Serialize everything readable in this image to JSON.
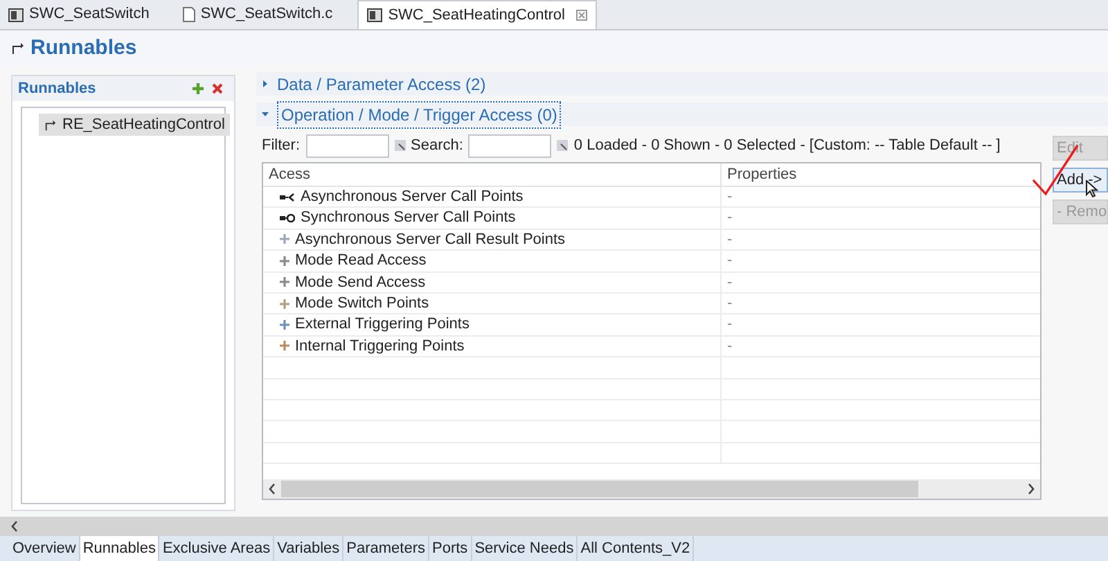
{
  "editor_tabs": [
    {
      "label": "SWC_SeatSwitch",
      "kind": "component",
      "selected": false
    },
    {
      "label": "SWC_SeatSwitch.c",
      "kind": "file",
      "selected": false
    },
    {
      "label": "SWC_SeatHeatingControl",
      "kind": "component",
      "selected": true
    }
  ],
  "page_title": "Runnables",
  "runnables_panel": {
    "title": "Runnables",
    "items": [
      {
        "label": "RE_SeatHeatingControl",
        "selected": true
      }
    ]
  },
  "sections": [
    {
      "title": "Data / Parameter Access (2)",
      "expanded": false
    },
    {
      "title": "Operation / Mode / Trigger Access (0)",
      "expanded": true
    }
  ],
  "filter": {
    "label": "Filter:"
  },
  "search": {
    "label": "Search:"
  },
  "status": "0 Loaded - 0 Shown - 0 Selected -  [Custom: -- Table Default -- ]",
  "table": {
    "columns": [
      "Acess",
      "Properties"
    ],
    "rows": [
      {
        "kind": "call-async",
        "name": "Asynchronous Server Call Points",
        "value": "-"
      },
      {
        "kind": "call-sync",
        "name": "Synchronous Server Call Points",
        "value": "-"
      },
      {
        "kind": "item",
        "color": "#9aa8b8",
        "name": "Asynchronous Server Call Result Points",
        "value": "-"
      },
      {
        "kind": "item",
        "color": "#8a8a8a",
        "name": "Mode Read Access",
        "value": "-"
      },
      {
        "kind": "item",
        "color": "#8a8a8a",
        "name": "Mode Send Access",
        "value": "-"
      },
      {
        "kind": "item",
        "color": "#b0a080",
        "name": "Mode Switch Points",
        "value": "-"
      },
      {
        "kind": "item",
        "color": "#6f8fc0",
        "name": "External Triggering Points",
        "value": "-"
      },
      {
        "kind": "item",
        "color": "#c08a60",
        "name": "Internal Triggering Points",
        "value": "-"
      }
    ]
  },
  "buttons": [
    {
      "label": "Edit",
      "disabled": true
    },
    {
      "label": "Add ->",
      "disabled": false
    },
    {
      "label": "- Remo",
      "disabled": true
    }
  ],
  "bottom_tabs": [
    {
      "label": "Overview",
      "selected": false
    },
    {
      "label": "Runnables",
      "selected": true
    },
    {
      "label": "Exclusive Areas",
      "selected": false
    },
    {
      "label": "Variables",
      "selected": false
    },
    {
      "label": "Parameters",
      "selected": false
    },
    {
      "label": "Ports",
      "selected": false
    },
    {
      "label": "Service Needs",
      "selected": false
    },
    {
      "label": "All Contents_V2",
      "selected": false
    }
  ]
}
